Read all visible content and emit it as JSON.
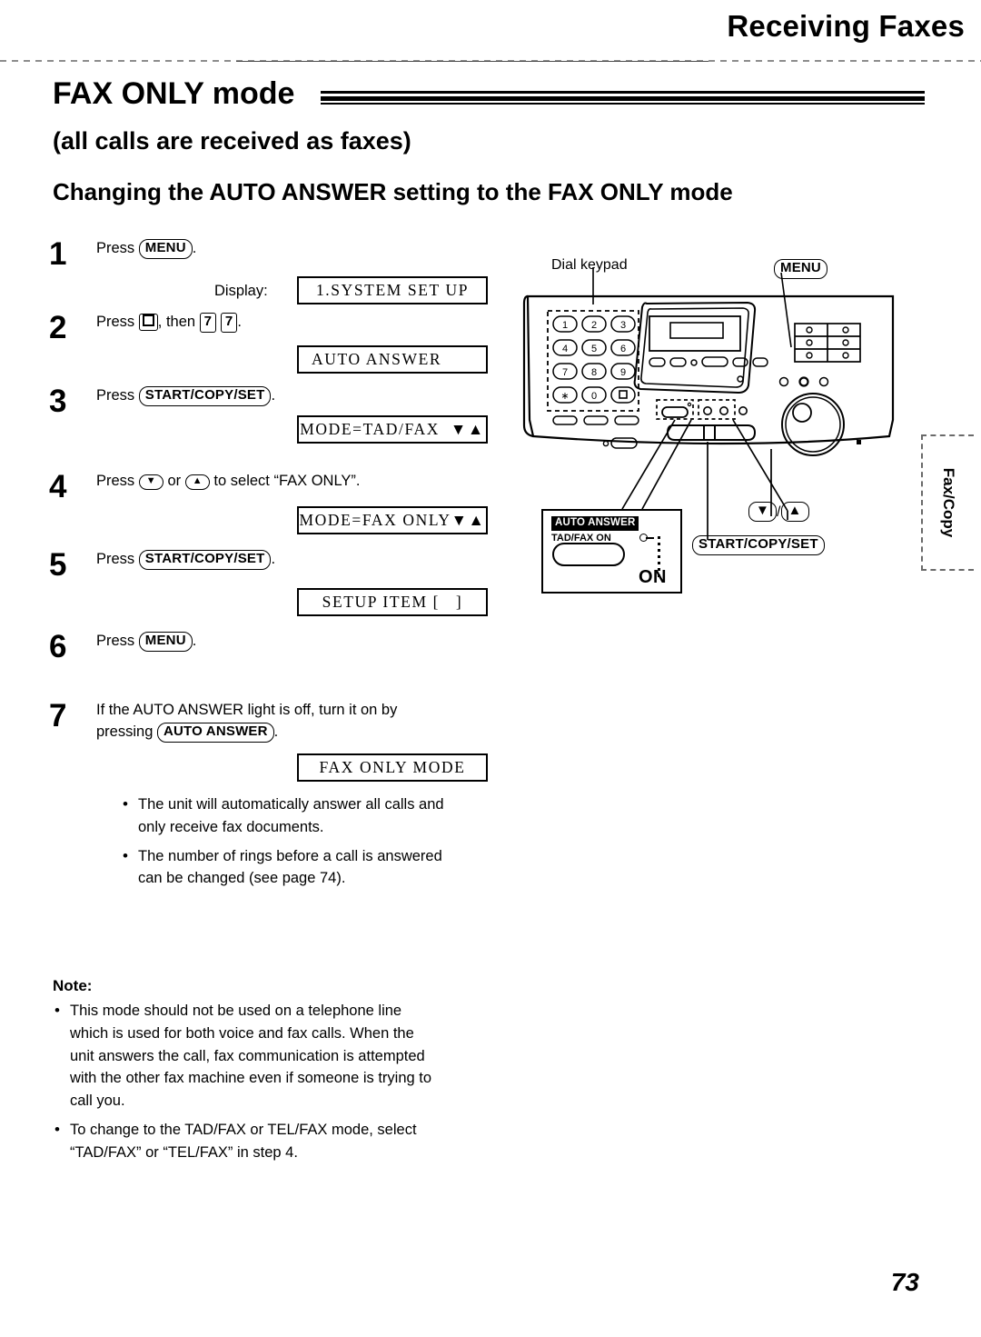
{
  "header": {
    "running_head": "Receiving Faxes"
  },
  "titles": {
    "h1": "FAX ONLY mode",
    "h2": "(all calls are received as faxes)",
    "h3": "Changing the AUTO ANSWER setting to the FAX ONLY mode"
  },
  "labels": {
    "display_label": "Display:",
    "press": "Press",
    "then": ", then",
    "or": "or",
    "period": ".",
    "comma": ","
  },
  "keys": {
    "menu": "MENU",
    "start_copy_set": "START/COPY/SET",
    "auto_answer": "AUTO ANSWER",
    "seven": "7",
    "hash_icon": "hash-key-icon",
    "down_arrow": "▼",
    "up_arrow": "▲"
  },
  "steps": [
    {
      "num": "1",
      "lines": [
        "Press  (MENU) ."
      ],
      "text_prefix": "Press",
      "key": "MENU",
      "display": "1.SYSTEM SET UP",
      "has_display_label": true
    },
    {
      "num": "2",
      "text_prefix": "Press",
      "text_mid": ", then",
      "keys": [
        "7",
        "7"
      ],
      "display": "AUTO ANSWER"
    },
    {
      "num": "3",
      "text_prefix": "Press",
      "key": "START/COPY/SET",
      "display": "MODE=TAD/FAX  ▼▲"
    },
    {
      "num": "4",
      "text_prefix": "Press",
      "text_mid": "or",
      "text_suffix": "to select “FAX ONLY”.",
      "display": "MODE=FAX ONLY▼▲"
    },
    {
      "num": "5",
      "text_prefix": "Press",
      "key": "START/COPY/SET",
      "display": "SETUP ITEM [   ]"
    },
    {
      "num": "6",
      "text_prefix": "Press",
      "key": "MENU",
      "display": null
    },
    {
      "num": "7",
      "line1": "If the AUTO ANSWER light is off, turn it on by",
      "line2_prefix": "pressing",
      "key": "AUTO ANSWER",
      "display": "FAX ONLY MODE"
    }
  ],
  "step7_bullets": [
    {
      "lines": [
        "The unit will automatically answer all calls and",
        "only receive fax documents."
      ]
    },
    {
      "lines": [
        "The number of rings before a call is answered",
        "can be changed (see page 74)."
      ]
    }
  ],
  "note": {
    "title": "Note:",
    "bullets": [
      {
        "lines": [
          "This mode should not be used on a telephone line",
          "which is used for both voice and fax calls. When the",
          "unit answers the call, fax communication is attempted",
          "with the other fax machine even if someone is trying to",
          "call you."
        ]
      },
      {
        "lines": [
          "To change to the TAD/FAX or TEL/FAX mode, select",
          "“TAD/FAX” or “TEL/FAX” in step 4."
        ]
      }
    ]
  },
  "illustration": {
    "callout_dial_keypad": "Dial keypad",
    "callout_menu": "MENU",
    "callout_start_copy_set": "START/COPY/SET",
    "callout_down": "▼",
    "callout_slash": "/",
    "callout_up": "▲",
    "auto_answer_tag": "AUTO ANSWER",
    "auto_answer_sub": "TAD/FAX ON",
    "auto_answer_on": "ON",
    "keypad_keys": [
      "1",
      "2",
      "3",
      "4",
      "5",
      "6",
      "7",
      "8",
      "9",
      "∗",
      "0",
      "□"
    ]
  },
  "index_tab": {
    "label": "Fax/Copy"
  },
  "folio": {
    "page_number": "73"
  },
  "colors": {
    "ink": "#000000",
    "paper": "#ffffff",
    "rule_gray": "#8d8d8d",
    "tab_dash": "#6a6a6a"
  }
}
